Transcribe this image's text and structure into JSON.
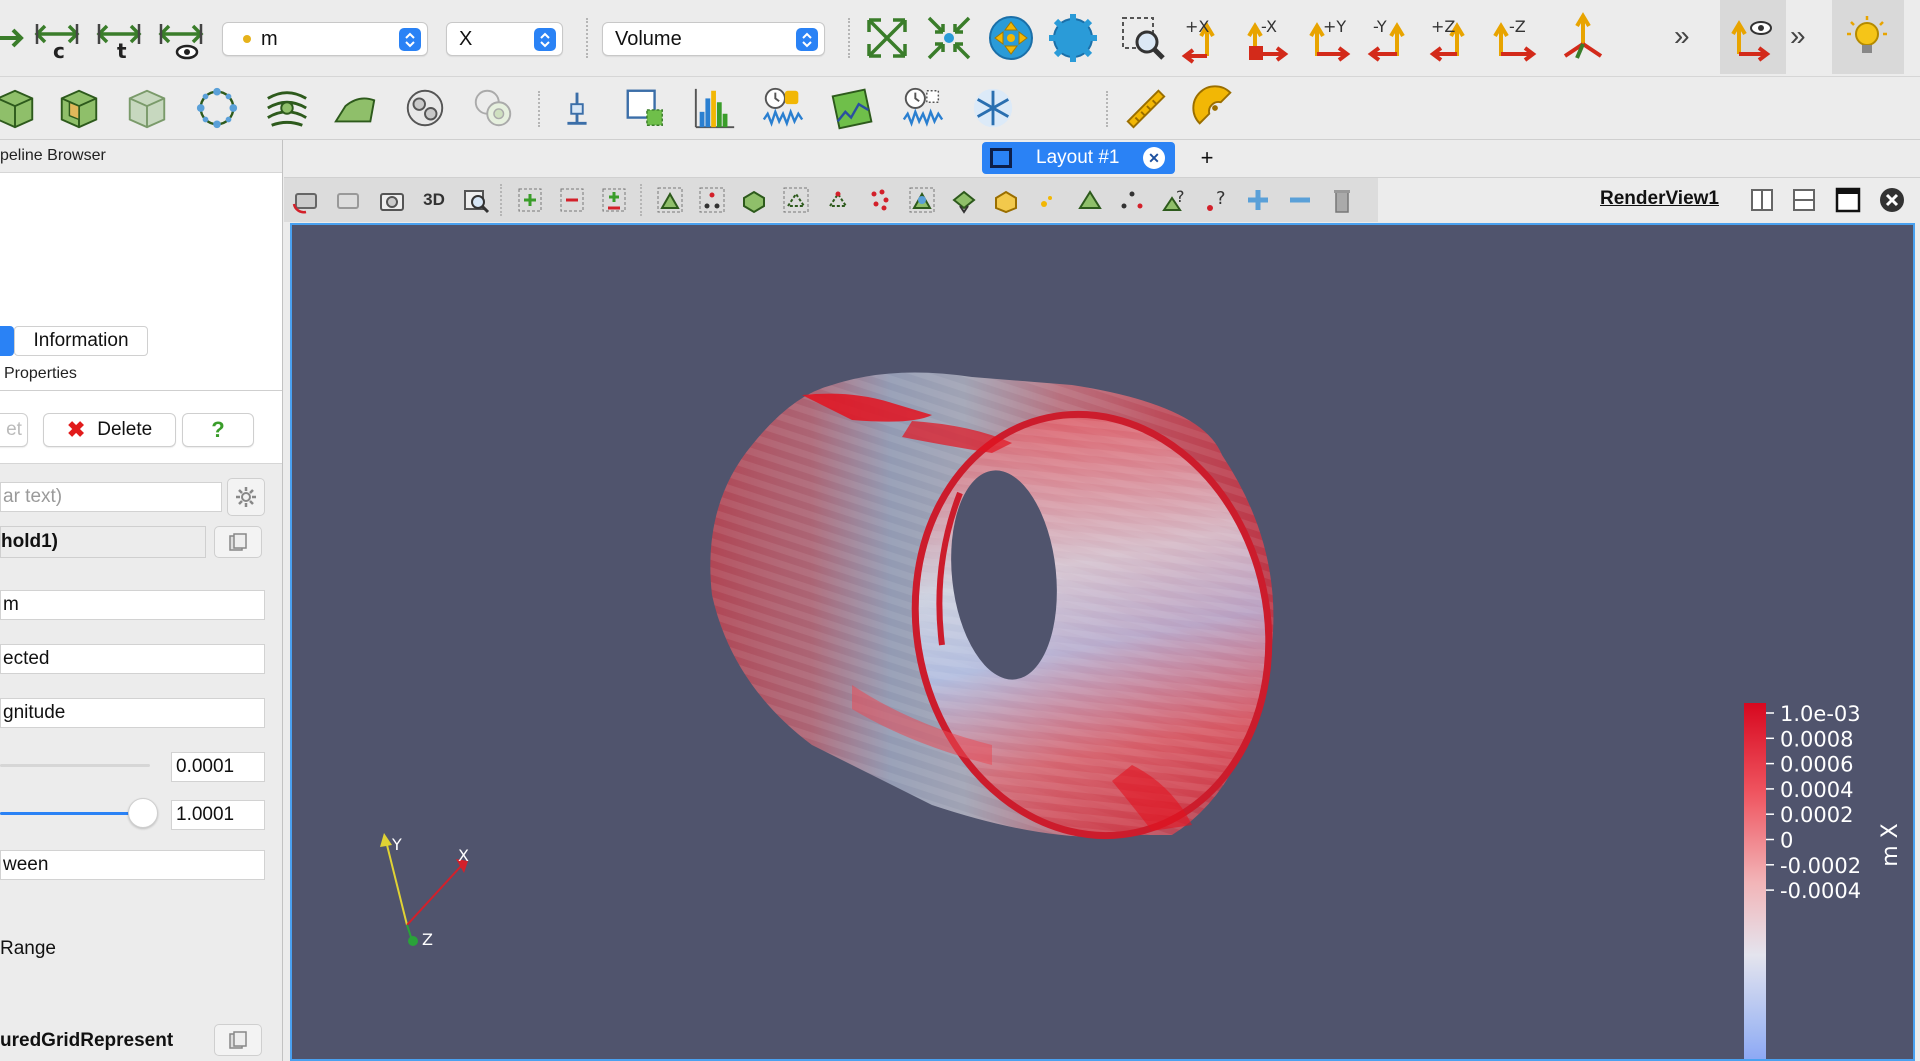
{
  "toolbar_top": {
    "array_combo": {
      "value": "m"
    },
    "component_combo": {
      "value": "X"
    },
    "representation_combo": {
      "value": "Volume"
    },
    "axis_labels": {
      "px": "+X",
      "mx": "-X",
      "py": "+Y",
      "my": "-Y",
      "pz": "+Z",
      "mz": "-Z"
    },
    "overflow": "»"
  },
  "toolbar_second": {
    "python_braces": "{...}"
  },
  "pipeline": {
    "header": "Pipeline Browser",
    "header_visible": "peline Browser"
  },
  "left_panel": {
    "information_tab": "Information",
    "properties_header": "Properties",
    "reset_partial": "et",
    "delete_label": "Delete",
    "help_label": "?",
    "search_placeholder": "ar text)",
    "object_name": "hold1)",
    "fields": [
      "m",
      "ected",
      "gnitude"
    ],
    "range_min": "0.0001",
    "range_max": "1.0001",
    "method": "ween",
    "range_label": "Range",
    "representation_name": "uredGridRepresent",
    "slider_fraction": 0.95
  },
  "view": {
    "layout_tab": "Layout #1",
    "add_tab": "+",
    "threeD_label": "3D",
    "render_view_name": "RenderView1",
    "background_color": "#50546d",
    "axes": {
      "x": "X",
      "y": "Y",
      "z": "Z"
    }
  },
  "colorbar": {
    "title": "m X",
    "labels": [
      "1.0e-03",
      "0.0008",
      "0.0006",
      "0.0004",
      "0.0002",
      "0",
      "-0.0002",
      "-0.0004"
    ],
    "colormap": [
      "#d7081f",
      "#f29ba0",
      "#e8e8f0",
      "#a8bdf2",
      "#8aa6f5"
    ]
  }
}
